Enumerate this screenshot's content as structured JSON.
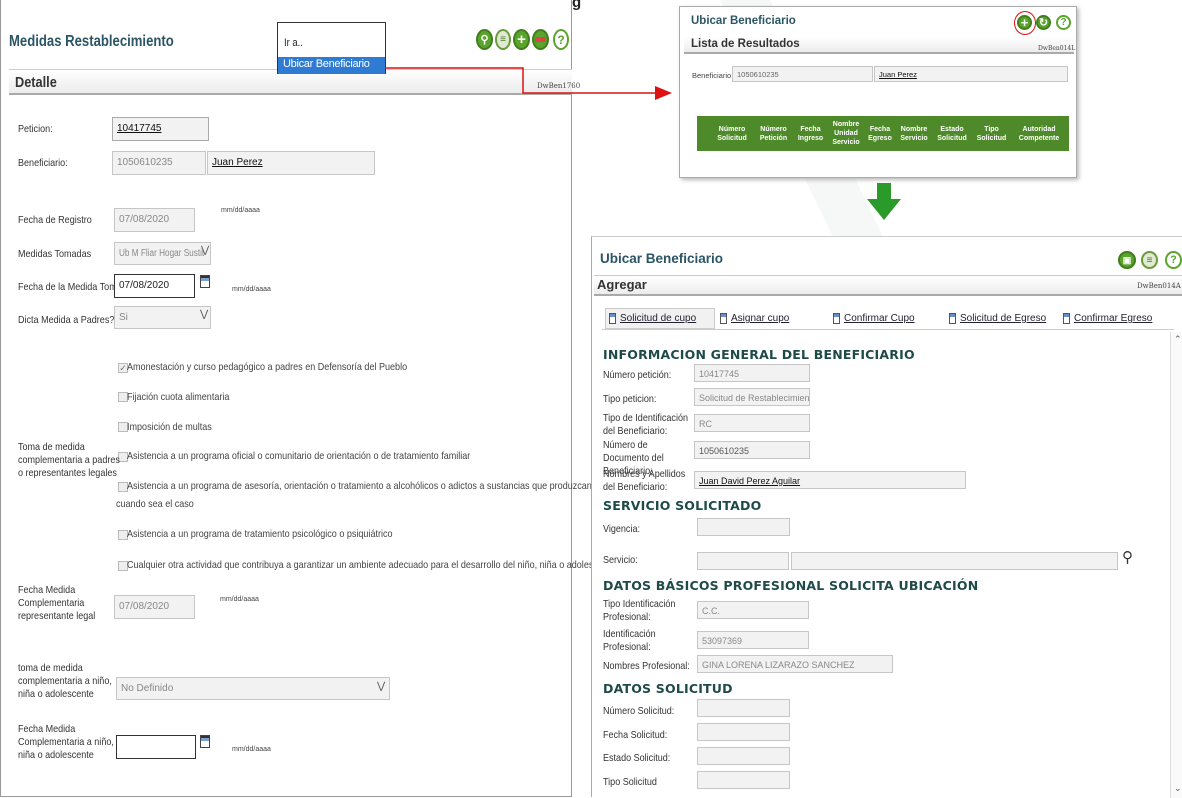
{
  "left": {
    "title": "Medidas Restablecimiento",
    "subtitle": "Detalle",
    "code": "DwBen1760",
    "goto": {
      "prompt": "Ir a..",
      "selected": "Ubicar Beneficiario"
    },
    "labels": {
      "peticion": "Peticion:",
      "beneficiario": "Beneficiario:",
      "fecha_registro": "Fecha de Registro",
      "medidas_tomadas": "Medidas Tomadas",
      "fecha_medida": "Fecha de la Medida Tomada",
      "dicta": "Dicta Medida a Padres?",
      "toma_medida": "Toma de medida complementaria a padres o representantes legales",
      "fecha_comp": "Fecha Medida Complementaria representante legal",
      "toma_nino": "toma de medida complementaria a niño, niña o adolescente",
      "fecha_nino": "Fecha Medida Complementaria a niño, niña o adolescente"
    },
    "values": {
      "peticion": "10417745",
      "beneficiario_id": "1050610235",
      "beneficiario_name": "Juan Perez",
      "fecha_registro": "07/08/2020",
      "medidas_tomadas": "Ub M Fliar Hogar Sustit",
      "fecha_medida": "07/08/2020",
      "dicta": "Si",
      "fecha_comp": "07/08/2020",
      "toma_nino": "No Definido",
      "fecha_nino": ""
    },
    "date_format": "mm/dd/aaaa",
    "checkboxes": [
      {
        "label": "Amonestación y curso pedagógico a padres en Defensoría del Pueblo",
        "checked": true
      },
      {
        "label": "Fijación cuota alimentaria",
        "checked": false
      },
      {
        "label": "Imposición de multas",
        "checked": false
      },
      {
        "label": "Asistencia a un programa oficial o comunitario de orientación o de tratamiento familiar",
        "checked": false
      },
      {
        "label": "Asistencia a un programa de asesoría, orientación o tratamiento a alcohólicos o adictos a sustancias que produzcan dependencia,",
        "label2": "cuando sea el caso",
        "checked": false
      },
      {
        "label": "Asistencia a un programa de tratamiento psicológico o psiquiátrico",
        "checked": false
      },
      {
        "label": "Cualquier otra actividad que contribuya a garantizar un ambiente adecuado para el desarrollo del niño, niña o adolescente",
        "checked": false
      }
    ]
  },
  "top_title_fragment": "g",
  "search_panel": {
    "title": "Ubicar Beneficiario",
    "subtitle": "Lista de Resultados",
    "code": "DwBen014L",
    "beneficiario_label": "Beneficiario:",
    "beneficiario_id": "1050610235",
    "beneficiario_name": "Juan Perez",
    "columns": [
      [
        "Número",
        "Solicitud"
      ],
      [
        "Número",
        "Petición"
      ],
      [
        "Fecha",
        "Ingreso"
      ],
      [
        "Nombre",
        "Unidad",
        "Servicio"
      ],
      [
        "Fecha",
        "Egreso"
      ],
      [
        "Nombre",
        "Servicio"
      ],
      [
        "Estado",
        "Solicitud"
      ],
      [
        "Tipo",
        "Solicitud"
      ],
      [
        "Autoridad",
        "Competente"
      ]
    ]
  },
  "add_panel": {
    "title": "Ubicar Beneficiario",
    "subtitle": "Agregar",
    "code": "DwBen014A",
    "tabs": [
      "Solicitud de cupo",
      "Asignar cupo",
      "Confirmar Cupo",
      "Solicitud de Egreso",
      "Confirmar Egreso"
    ],
    "sections": {
      "info": "INFORMACION GENERAL DEL BENEFICIARIO",
      "servicio": "SERVICIO SOLICITADO",
      "profesional": "DATOS BÁSICOS PROFESIONAL SOLICITA UBICACIÓN",
      "solicitud": "DATOS SOLICITUD"
    },
    "labels": {
      "num_peticion": "Número petición:",
      "tipo_peticion": "Tipo peticion:",
      "tipo_id": "Tipo de Identificación del Beneficiario:",
      "num_doc": "Número de Documento del Beneficiario:",
      "nombres": "Nombres y Apellidos del Beneficiario:",
      "vigencia": "Vigencia:",
      "servicio": "Servicio:",
      "tipo_id_prof": "Tipo Identificación Profesional:",
      "id_prof": "Identificación Profesional:",
      "nombres_prof": "Nombres Profesional:",
      "num_sol": "Número Solicitud:",
      "fecha_sol": "Fecha Solicitud:",
      "estado_sol": "Estado Solicitud:",
      "tipo_sol": "Tipo Solicitud"
    },
    "values": {
      "num_peticion": "10417745",
      "tipo_peticion": "Solicitud de Restablecimient",
      "tipo_id": "RC",
      "num_doc": "1050610235",
      "nombres": "Juan David Perez Aguilar",
      "tipo_id_prof": "C.C.",
      "id_prof": "53097369",
      "nombres_prof": "GINA LORENA LIZARAZO SANCHEZ"
    }
  },
  "colors": {
    "green": "#59a52c",
    "table_green": "#4f8a2a",
    "arrow_red": "#d11",
    "arrow_green": "#2a9a2a",
    "title": "#2b5566"
  }
}
